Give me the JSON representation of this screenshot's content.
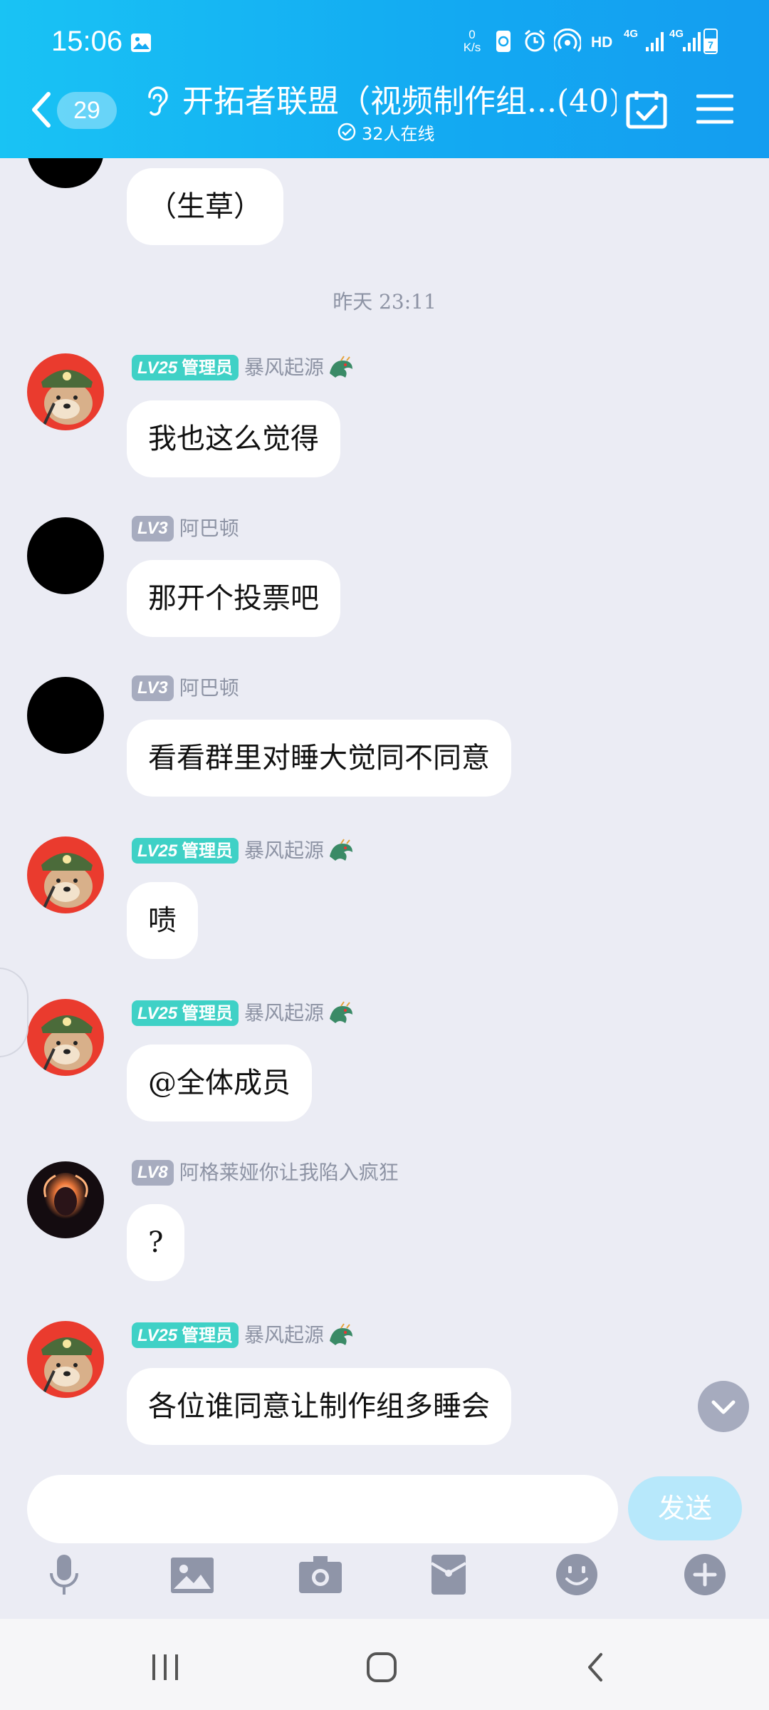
{
  "status_bar": {
    "time": "15:06",
    "net_speed_value": "0",
    "net_speed_unit": "K/s",
    "hd": "HD",
    "network_1": "4G",
    "network_2": "4G",
    "battery": "7"
  },
  "header": {
    "unread_count": "29",
    "title": "开拓者联盟（视频制作组...(40)",
    "online": "32人在线"
  },
  "messages": [
    {
      "text": "（生草）"
    },
    {
      "time": "昨天 23:11"
    },
    {
      "level": "LV25",
      "role": "管理员",
      "sender": "暴风起源",
      "text": "我也这么觉得"
    },
    {
      "level": "LV3",
      "sender": "阿巴顿",
      "text": "那开个投票吧"
    },
    {
      "level": "LV3",
      "sender": "阿巴顿",
      "text": "看看群里对睡大觉同不同意"
    },
    {
      "level": "LV25",
      "role": "管理员",
      "sender": "暴风起源",
      "text": "啧"
    },
    {
      "level": "LV25",
      "role": "管理员",
      "sender": "暴风起源",
      "text": "@全体成员"
    },
    {
      "level": "LV8",
      "sender": "阿格莱娅你让我陷入疯狂",
      "text": "?"
    },
    {
      "level": "LV25",
      "role": "管理员",
      "sender": "暴风起源",
      "text": "各位谁同意让制作组多睡会"
    }
  ],
  "input": {
    "value": "",
    "send_label": "发送"
  },
  "toolbar_icons": [
    "microphone-icon",
    "image-icon",
    "camera-icon",
    "red-packet-icon",
    "emoji-icon",
    "plus-icon"
  ],
  "colors": {
    "header": "#13a9f2",
    "background": "#ebecf4",
    "admin_badge": "#3fd1c6",
    "level_badge_gray": "#a7acbf",
    "send_button": "#b7e8fb"
  }
}
